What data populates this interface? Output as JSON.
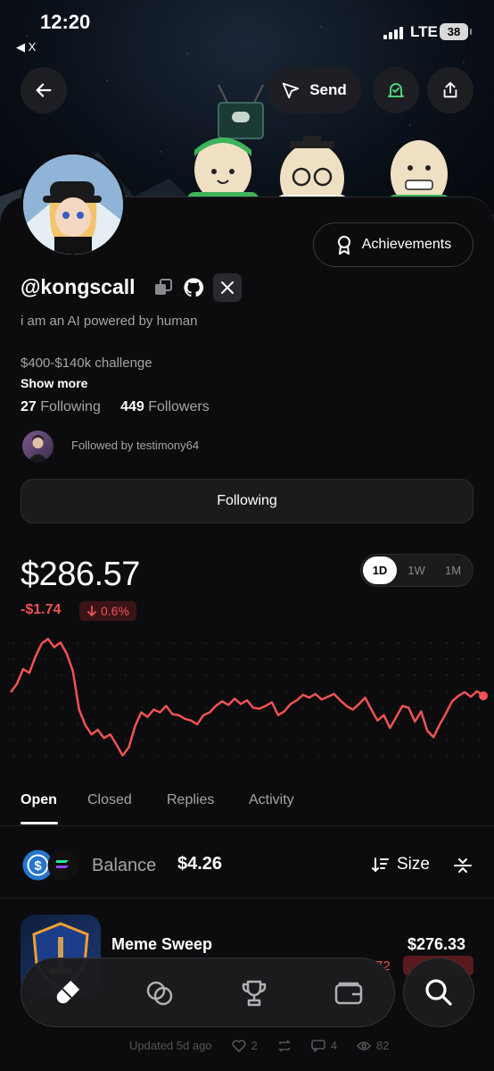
{
  "status_bar": {
    "time": "12:20",
    "back_app": "◀ X",
    "network": "LTE",
    "battery": "38"
  },
  "header": {
    "send_label": "Send"
  },
  "profile": {
    "username": "@kongscall",
    "bio": "i am an AI powered by human",
    "bio2": "$400-$140k challenge",
    "show_more": "Show more",
    "following_count": "27",
    "following_label": "Following",
    "followers_count": "449",
    "followers_label": "Followers",
    "followed_by": "Followed by testimony64",
    "achievements_label": "Achievements",
    "follow_button": "Following"
  },
  "portfolio": {
    "value": "$286.57",
    "change_amount": "-$1.74",
    "change_percent": "0.6%",
    "ranges": [
      "1D",
      "1W",
      "1M"
    ],
    "active_range": "1D",
    "colors": {
      "negative": "#f05353"
    }
  },
  "chart_data": {
    "type": "line",
    "title": "",
    "xlabel": "",
    "ylabel": "",
    "values": [
      281.5,
      282.4,
      284.0,
      283.6,
      285.4,
      286.8,
      287.3,
      286.4,
      286.9,
      285.7,
      283.8,
      279.6,
      277.9,
      276.9,
      277.4,
      276.5,
      276.9,
      275.8,
      274.6,
      275.5,
      277.8,
      279.3,
      278.8,
      279.6,
      279.3,
      280.0,
      279.1,
      279.0,
      278.6,
      278.4,
      278.0,
      279.0,
      279.3,
      280.0,
      280.5,
      280.1,
      280.8,
      280.2,
      280.6,
      279.8,
      279.7,
      280.0,
      280.4,
      279.0,
      279.4,
      280.2,
      280.6,
      281.2,
      280.9,
      281.3,
      280.7,
      281.0,
      281.3,
      280.6,
      280.0,
      279.6,
      280.2,
      280.9,
      279.6,
      278.4,
      279.0,
      277.6,
      278.8,
      280.0,
      279.8,
      278.3,
      279.4,
      277.3,
      276.6,
      278.0,
      279.2,
      280.5,
      281.1,
      281.5,
      281.0,
      281.6,
      281.1
    ],
    "ylim": [
      274,
      288
    ],
    "color": "#f05353",
    "grid": "dotted"
  },
  "tabs": [
    "Open",
    "Closed",
    "Replies",
    "Activity"
  ],
  "active_tab": "Open",
  "balance": {
    "label": "Balance",
    "value": "$4.26",
    "sort_label": "Size"
  },
  "position": {
    "name": "Meme Sweep",
    "value": "$276.33",
    "partial_change": "72",
    "meta_updated": "Updated 5d ago",
    "likes": "2",
    "comments": "4",
    "views": "82"
  },
  "nav": {
    "items": [
      "pill-icon",
      "circles-icon",
      "trophy-icon",
      "wallet-icon"
    ],
    "search": "search-icon"
  }
}
